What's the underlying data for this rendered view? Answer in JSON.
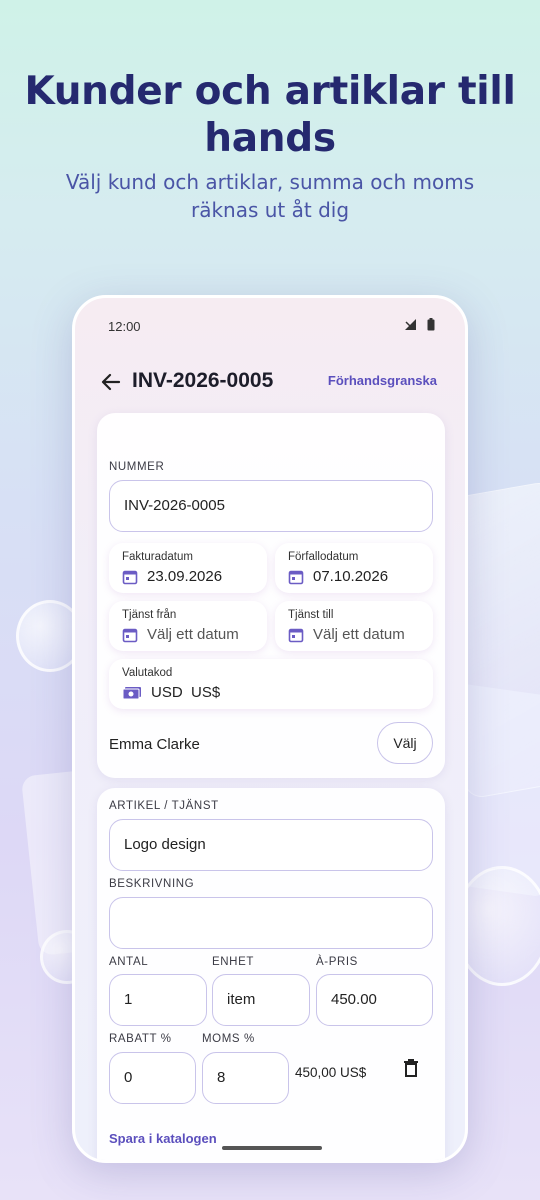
{
  "promo": {
    "title": "Kunder och artiklar till hands",
    "subtitle": "Välj kund och artiklar, summa och moms räknas ut åt dig"
  },
  "status_bar": {
    "time": "12:00"
  },
  "app_bar": {
    "title": "INV-2026-0005",
    "preview_label": "Förhandsgranska"
  },
  "invoice": {
    "number_label": "NUMMER",
    "number_value": "INV-2026-0005",
    "invoice_date_label": "Fakturadatum",
    "invoice_date_value": "23.09.2026",
    "due_date_label": "Förfallodatum",
    "due_date_value": "07.10.2026",
    "service_from_label": "Tjänst från",
    "service_from_placeholder": "Välj ett datum",
    "service_to_label": "Tjänst till",
    "service_to_placeholder": "Välj ett datum",
    "currency_label": "Valutakod",
    "currency_value": "USD  US$",
    "customer_name": "Emma Clarke",
    "choose_label": "Välj"
  },
  "item": {
    "article_label": "ARTIKEL / TJÄNST",
    "article_value": "Logo design",
    "description_label": "BESKRIVNING",
    "description_value": "",
    "quantity_label": "ANTAL",
    "quantity_value": "1",
    "unit_label": "ENHET",
    "unit_value": "item",
    "price_label": "À-PRIS",
    "price_value": "450.00",
    "discount_label": "RABATT %",
    "discount_value": "0",
    "vat_label": "MOMS %",
    "vat_value": "8",
    "line_total": "450,00 US$",
    "save_catalog_label": "Spara i katalogen"
  },
  "colors": {
    "title": "#25296f",
    "subtitle": "#4a55a6",
    "accent": "#5b4fbd",
    "field_border": "#c9c4ea"
  },
  "icons": [
    "back-arrow-icon",
    "calendar-icon",
    "money-icon",
    "trash-icon",
    "signal-icon",
    "battery-icon"
  ]
}
